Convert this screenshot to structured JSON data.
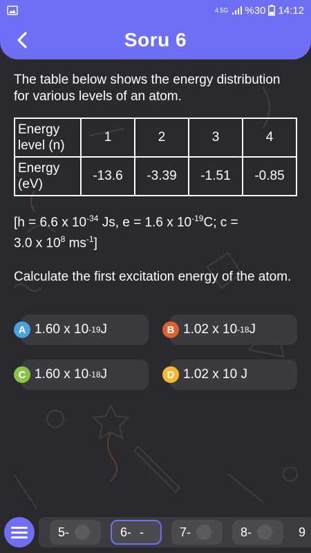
{
  "status_bar": {
    "network": "4.5G",
    "battery": "%30",
    "time": "14:12"
  },
  "header": {
    "title": "Soru 6",
    "back_icon": "chevron-left-icon"
  },
  "question": {
    "intro": "The table below shows the energy distribution for various levels of an atom.",
    "table": {
      "row1_label": "Energy level (n)",
      "levels": [
        "1",
        "2",
        "3",
        "4"
      ],
      "row2_label": "Energy (eV)",
      "energies": [
        "-13.6",
        "-3.39",
        "-1.51",
        "-0.85"
      ]
    },
    "constants": {
      "open": "[h = 6.6 x 10",
      "h_exp": "-34",
      "h_unit": " Js, e = 1.6 x 10",
      "e_exp": "-19",
      "e_unit": "C; c =",
      "c_value": "3.0 x 10",
      "c_exp": "8",
      "c_unit": " ms",
      "c_unit_exp": "-1",
      "close": "]"
    },
    "prompt": "Calculate the first excitation energy of the atom."
  },
  "options": [
    {
      "letter": "A",
      "base": "1.60 x 10",
      "exp": "-19",
      "unit": " J",
      "color": "#4aa3df"
    },
    {
      "letter": "B",
      "base": "1.02 x 10",
      "exp": "-18",
      "unit": " J",
      "color": "#e0602e"
    },
    {
      "letter": "C",
      "base": "1.60 x 10",
      "exp": "-18",
      "unit": " J",
      "color": "#8bc34a"
    },
    {
      "letter": "D",
      "base": "1.02 x 10 J",
      "exp": "",
      "unit": "",
      "color": "#f5b82e"
    }
  ],
  "bottom_nav": {
    "menu_icon": "hamburger-menu-icon",
    "questions": [
      {
        "label": "5-",
        "state": ""
      },
      {
        "label": "6-",
        "state": "-"
      },
      {
        "label": "7-",
        "state": ""
      },
      {
        "label": "8-",
        "state": ""
      },
      {
        "label": "9",
        "state": ""
      }
    ]
  },
  "colors": {
    "accent": "#6f6ff5",
    "background": "#2a2a2e",
    "option_bg": "#3a3a3f"
  }
}
